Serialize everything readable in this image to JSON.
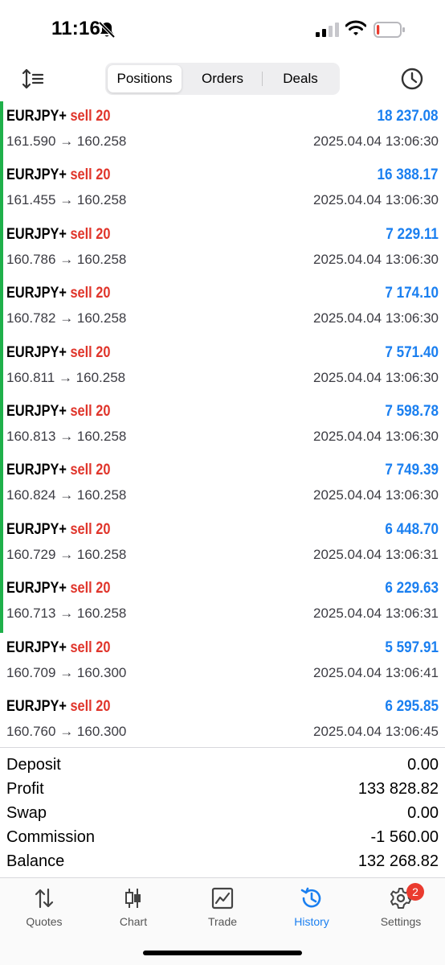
{
  "status_bar": {
    "time": "11:16",
    "battery_level": 0.12
  },
  "toolbar": {
    "tabs": [
      {
        "label": "Positions",
        "selected": true
      },
      {
        "label": "Orders",
        "selected": false
      },
      {
        "label": "Deals",
        "selected": false
      }
    ]
  },
  "positions": [
    {
      "symbol": "EURJPY+",
      "side": "sell 20",
      "open_price": "161.590",
      "close_price": "160.258",
      "profit": "18 237.08",
      "time": "2025.04.04 13:06:30"
    },
    {
      "symbol": "EURJPY+",
      "side": "sell 20",
      "open_price": "161.455",
      "close_price": "160.258",
      "profit": "16 388.17",
      "time": "2025.04.04 13:06:30"
    },
    {
      "symbol": "EURJPY+",
      "side": "sell 20",
      "open_price": "160.786",
      "close_price": "160.258",
      "profit": "7 229.11",
      "time": "2025.04.04 13:06:30"
    },
    {
      "symbol": "EURJPY+",
      "side": "sell 20",
      "open_price": "160.782",
      "close_price": "160.258",
      "profit": "7 174.10",
      "time": "2025.04.04 13:06:30"
    },
    {
      "symbol": "EURJPY+",
      "side": "sell 20",
      "open_price": "160.811",
      "close_price": "160.258",
      "profit": "7 571.40",
      "time": "2025.04.04 13:06:30"
    },
    {
      "symbol": "EURJPY+",
      "side": "sell 20",
      "open_price": "160.813",
      "close_price": "160.258",
      "profit": "7 598.78",
      "time": "2025.04.04 13:06:30"
    },
    {
      "symbol": "EURJPY+",
      "side": "sell 20",
      "open_price": "160.824",
      "close_price": "160.258",
      "profit": "7 749.39",
      "time": "2025.04.04 13:06:30"
    },
    {
      "symbol": "EURJPY+",
      "side": "sell 20",
      "open_price": "160.729",
      "close_price": "160.258",
      "profit": "6 448.70",
      "time": "2025.04.04 13:06:31"
    },
    {
      "symbol": "EURJPY+",
      "side": "sell 20",
      "open_price": "160.713",
      "close_price": "160.258",
      "profit": "6 229.63",
      "time": "2025.04.04 13:06:31"
    },
    {
      "symbol": "EURJPY+",
      "side": "sell 20",
      "open_price": "160.709",
      "close_price": "160.300",
      "profit": "5 597.91",
      "time": "2025.04.04 13:06:41"
    },
    {
      "symbol": "EURJPY+",
      "side": "sell 20",
      "open_price": "160.760",
      "close_price": "160.300",
      "profit": "6 295.85",
      "time": "2025.04.04 13:06:45"
    }
  ],
  "arrow": "→",
  "summary": [
    {
      "label": "Deposit",
      "value": "0.00"
    },
    {
      "label": "Profit",
      "value": "133 828.82"
    },
    {
      "label": "Swap",
      "value": "0.00"
    },
    {
      "label": "Commission",
      "value": "-1 560.00"
    },
    {
      "label": "Balance",
      "value": "132 268.82"
    }
  ],
  "tabbar": {
    "items": [
      {
        "label": "Quotes",
        "icon": "up-down-arrows-icon"
      },
      {
        "label": "Chart",
        "icon": "candlestick-icon"
      },
      {
        "label": "Trade",
        "icon": "line-chart-icon"
      },
      {
        "label": "History",
        "icon": "history-clock-icon",
        "active": true
      },
      {
        "label": "Settings",
        "icon": "gear-icon",
        "badge": "2"
      }
    ]
  },
  "colors": {
    "accent": "#1a7ff0",
    "sell": "#e0352b",
    "marker": "#1fb04a",
    "badge": "#ea3b2f"
  }
}
